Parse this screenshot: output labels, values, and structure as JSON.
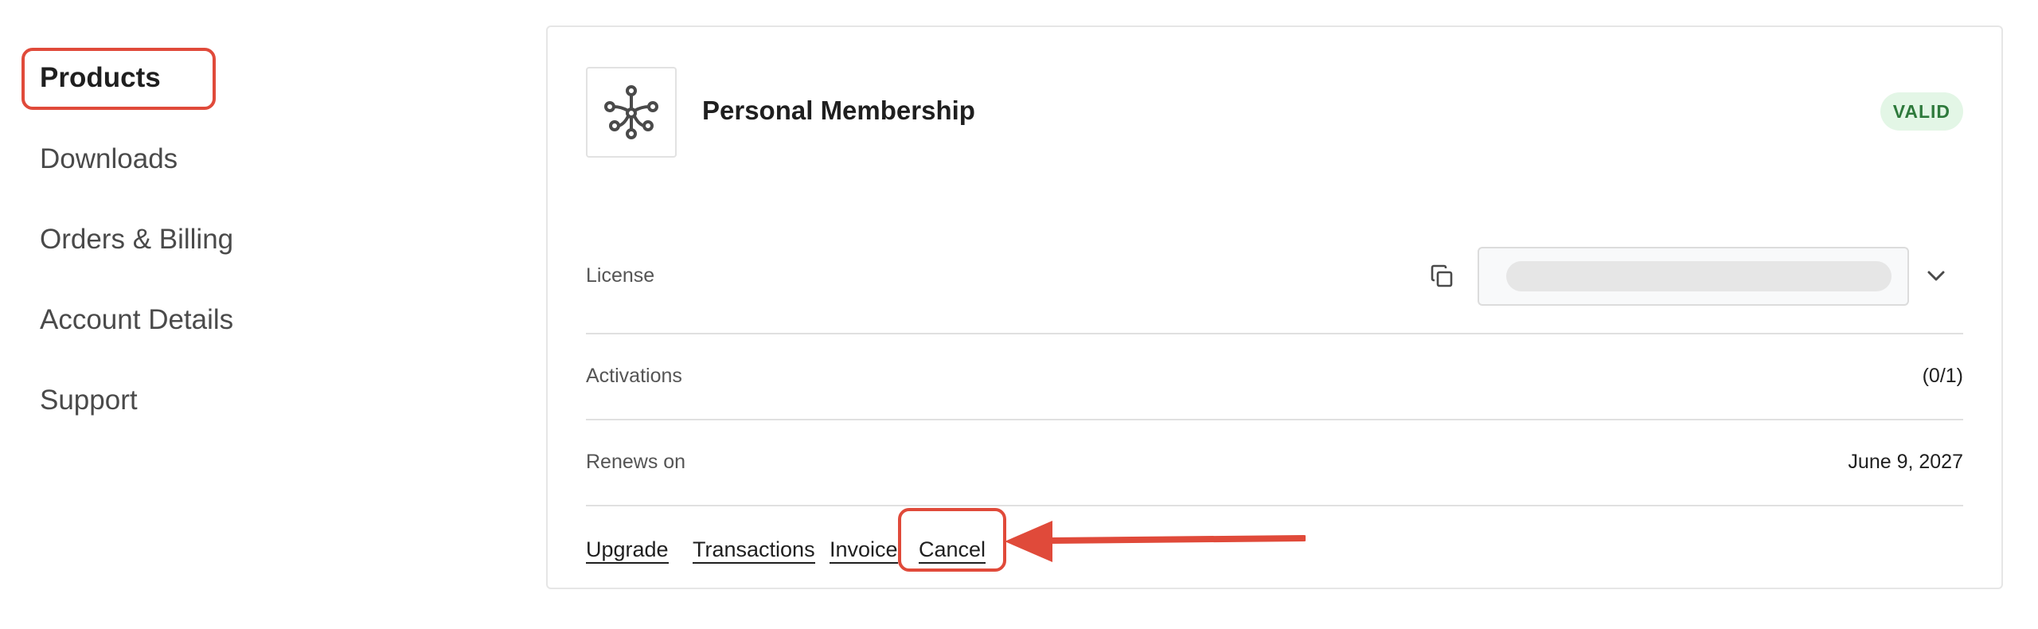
{
  "sidebar": {
    "items": [
      {
        "label": "Products",
        "active": true
      },
      {
        "label": "Downloads",
        "active": false
      },
      {
        "label": "Orders & Billing",
        "active": false
      },
      {
        "label": "Account Details",
        "active": false
      },
      {
        "label": "Support",
        "active": false
      }
    ]
  },
  "product": {
    "icon": "network-nodes-icon",
    "title": "Personal Membership",
    "status": "VALID"
  },
  "details": {
    "license_label": "License",
    "activations_label": "Activations",
    "activations_value": "(0/1)",
    "renews_label": "Renews on",
    "renews_value": "June 9, 2027"
  },
  "actions": {
    "upgrade": "Upgrade",
    "transactions": "Transactions",
    "invoice": "Invoice",
    "cancel": "Cancel"
  },
  "colors": {
    "annotation": "#e04a3a",
    "badge_bg": "#e3f6e6",
    "badge_text": "#2e7a3c"
  }
}
